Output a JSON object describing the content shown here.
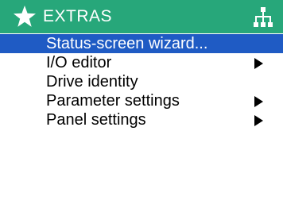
{
  "colors": {
    "header_bg": "#27a77a",
    "header_text": "#ffffff",
    "selection_bg": "#1f5bc4",
    "selection_text": "#ffffff",
    "text": "#000000"
  },
  "header": {
    "title": "EXTRAS",
    "left_icon": "star-icon",
    "right_icon": "network-topology-icon"
  },
  "menu": {
    "items": [
      {
        "label": "Status-screen wizard...",
        "selected": true,
        "has_submenu": false
      },
      {
        "label": "I/O editor",
        "selected": false,
        "has_submenu": true
      },
      {
        "label": "Drive identity",
        "selected": false,
        "has_submenu": false
      },
      {
        "label": "Parameter settings",
        "selected": false,
        "has_submenu": true
      },
      {
        "label": "Panel settings",
        "selected": false,
        "has_submenu": true
      }
    ]
  }
}
